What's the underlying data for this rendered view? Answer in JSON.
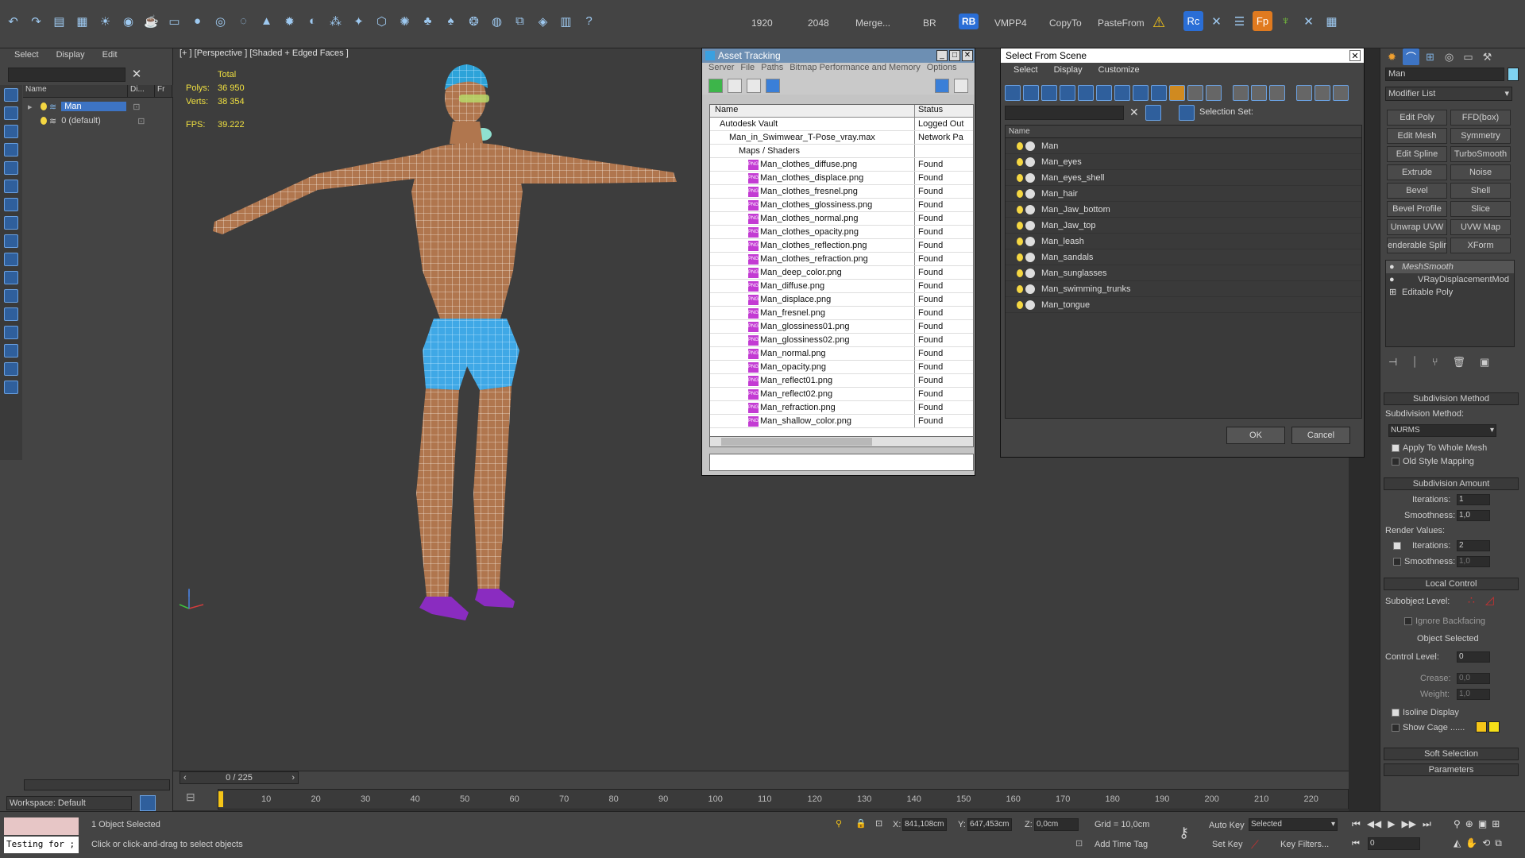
{
  "toolbar": {
    "labels": [
      "1920",
      "2048",
      "Merge...",
      "BR",
      "VMPP4",
      "CopyTo",
      "PasteFrom"
    ],
    "rb_badge": "RB",
    "rc_badge": "Rc",
    "fp_badge": "Fp"
  },
  "scene_explorer": {
    "menu": [
      "Select",
      "Display",
      "Edit"
    ],
    "columns": [
      "Name",
      "Di...",
      "Fr"
    ],
    "rows": [
      {
        "label": "Man",
        "selected": true
      },
      {
        "label": "0 (default)",
        "selected": false
      }
    ],
    "workspace": "Workspace: Default"
  },
  "viewport": {
    "label": "[+ ] [Perspective ] [Shaded + Edged Faces ]",
    "stats_header": "Total",
    "stats": [
      {
        "label": "Polys:",
        "value": "36 950"
      },
      {
        "label": "Verts:",
        "value": "38 354"
      },
      {
        "label": "FPS:",
        "value": "39.222"
      }
    ]
  },
  "asset_tracking": {
    "title": "Asset Tracking",
    "menu": [
      "Server",
      "File",
      "Paths",
      "Bitmap Performance and Memory",
      "Options"
    ],
    "columns": [
      "Name",
      "Status"
    ],
    "rows": [
      {
        "indent": 1,
        "name": "Autodesk Vault",
        "status": "Logged Out"
      },
      {
        "indent": 2,
        "name": "Man_in_Swimwear_T-Pose_vray.max",
        "status": "Network Pa"
      },
      {
        "indent": 3,
        "name": "Maps / Shaders",
        "status": ""
      },
      {
        "indent": 4,
        "name": "Man_clothes_diffuse.png",
        "status": "Found",
        "png": true
      },
      {
        "indent": 4,
        "name": "Man_clothes_displace.png",
        "status": "Found",
        "png": true
      },
      {
        "indent": 4,
        "name": "Man_clothes_fresnel.png",
        "status": "Found",
        "png": true
      },
      {
        "indent": 4,
        "name": "Man_clothes_glossiness.png",
        "status": "Found",
        "png": true
      },
      {
        "indent": 4,
        "name": "Man_clothes_normal.png",
        "status": "Found",
        "png": true
      },
      {
        "indent": 4,
        "name": "Man_clothes_opacity.png",
        "status": "Found",
        "png": true
      },
      {
        "indent": 4,
        "name": "Man_clothes_reflection.png",
        "status": "Found",
        "png": true
      },
      {
        "indent": 4,
        "name": "Man_clothes_refraction.png",
        "status": "Found",
        "png": true
      },
      {
        "indent": 4,
        "name": "Man_deep_color.png",
        "status": "Found",
        "png": true
      },
      {
        "indent": 4,
        "name": "Man_diffuse.png",
        "status": "Found",
        "png": true
      },
      {
        "indent": 4,
        "name": "Man_displace.png",
        "status": "Found",
        "png": true
      },
      {
        "indent": 4,
        "name": "Man_fresnel.png",
        "status": "Found",
        "png": true
      },
      {
        "indent": 4,
        "name": "Man_glossiness01.png",
        "status": "Found",
        "png": true
      },
      {
        "indent": 4,
        "name": "Man_glossiness02.png",
        "status": "Found",
        "png": true
      },
      {
        "indent": 4,
        "name": "Man_normal.png",
        "status": "Found",
        "png": true
      },
      {
        "indent": 4,
        "name": "Man_opacity.png",
        "status": "Found",
        "png": true
      },
      {
        "indent": 4,
        "name": "Man_reflect01.png",
        "status": "Found",
        "png": true
      },
      {
        "indent": 4,
        "name": "Man_reflect02.png",
        "status": "Found",
        "png": true
      },
      {
        "indent": 4,
        "name": "Man_refraction.png",
        "status": "Found",
        "png": true
      },
      {
        "indent": 4,
        "name": "Man_shallow_color.png",
        "status": "Found",
        "png": true
      }
    ]
  },
  "select_from_scene": {
    "title": "Select From Scene",
    "menu": [
      "Select",
      "Display",
      "Customize"
    ],
    "selection_set_label": "Selection Set:",
    "name_header": "Name",
    "items": [
      "Man",
      "Man_eyes",
      "Man_eyes_shell",
      "Man_hair",
      "Man_Jaw_bottom",
      "Man_Jaw_top",
      "Man_leash",
      "Man_sandals",
      "Man_sunglasses",
      "Man_swimming_trunks",
      "Man_tongue"
    ],
    "ok_label": "OK",
    "cancel_label": "Cancel"
  },
  "command_panel": {
    "object_name": "Man",
    "modifier_list": "Modifier List",
    "modifier_buttons": [
      "Edit Poly",
      "FFD(box)",
      "Edit Mesh",
      "Symmetry",
      "Edit Spline",
      "TurboSmooth",
      "Extrude",
      "Noise",
      "Bevel",
      "Shell",
      "Bevel Profile",
      "Slice",
      "Unwrap UVW",
      "UVW Map",
      "enderable Splir",
      "XForm"
    ],
    "stack": [
      "MeshSmooth",
      "VRayDisplacementMod",
      "Editable Poly"
    ],
    "rollout_subdivision_method": "Subdivision Method",
    "subdivision_method_label": "Subdivision Method:",
    "subdivision_method_value": "NURMS",
    "apply_whole_mesh": "Apply To Whole Mesh",
    "old_style_mapping": "Old Style Mapping",
    "rollout_subdivision_amount": "Subdivision Amount",
    "iterations_label": "Iterations:",
    "iterations_value": "1",
    "smoothness_label": "Smoothness:",
    "smoothness_value": "1,0",
    "render_values_label": "Render Values:",
    "render_iterations_value": "2",
    "render_smoothness_value": "1,0",
    "rollout_local_control": "Local Control",
    "subobject_level_label": "Subobject Level:",
    "ignore_backfacing": "Ignore Backfacing",
    "object_selected": "Object Selected",
    "control_level_label": "Control Level:",
    "control_level_value": "0",
    "crease_label": "Crease:",
    "crease_value": "0,0",
    "weight_label": "Weight:",
    "weight_value": "1,0",
    "isoline_display": "Isoline Display",
    "show_cage": "Show Cage ......",
    "rollout_soft_selection": "Soft Selection",
    "rollout_parameters": "Parameters"
  },
  "timeline": {
    "frame": "0 / 225",
    "ticks": [
      "10",
      "20",
      "30",
      "40",
      "50",
      "60",
      "70",
      "80",
      "90",
      "100",
      "110",
      "120",
      "130",
      "140",
      "150",
      "160",
      "170",
      "180",
      "190",
      "200",
      "210",
      "220"
    ]
  },
  "status_bar": {
    "testing": "Testing for ;",
    "selected_count": "1 Object Selected",
    "prompt": "Click or click-and-drag to select objects",
    "x_label": "X:",
    "x_value": "841,108cm",
    "y_label": "Y:",
    "y_value": "647,453cm",
    "z_label": "Z:",
    "z_value": "0,0cm",
    "grid": "Grid = 10,0cm",
    "add_time_tag": "Add Time Tag",
    "auto_key": "Auto Key",
    "selected_dropdown": "Selected",
    "set_key": "Set Key",
    "key_filters": "Key Filters...",
    "frame_field": "0"
  }
}
